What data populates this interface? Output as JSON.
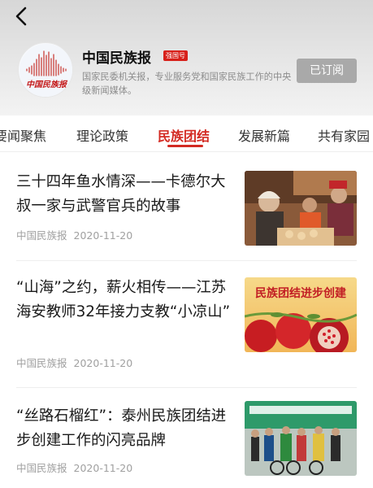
{
  "header": {
    "account_name": "中国民族报",
    "badge": "强国号",
    "description": "国家民委机关报，专业服务党和国家民族工作的中央级新闻媒体。",
    "subscribe_label": "已订阅",
    "logo_text": "中国民族报"
  },
  "tabs": [
    {
      "label": "要闻聚焦"
    },
    {
      "label": "理论政策"
    },
    {
      "label": "民族团结"
    },
    {
      "label": "发展新篇"
    },
    {
      "label": "共有家园"
    }
  ],
  "active_tab": "民族团结",
  "articles": [
    {
      "title": "三十四年鱼水情深——卡德尔大叔一家与武警官兵的故事",
      "source": "中国民族报",
      "date": "2020-11-20"
    },
    {
      "title": "“山海”之约，薪火相传——江苏海安教师32年接力支教“小凉山”",
      "source": "中国民族报",
      "date": "2020-11-20",
      "image_text": "民族团结进步创建"
    },
    {
      "title": "“丝路石榴红”：泰州民族团结进步创建工作的闪亮品牌",
      "source": "中国民族报",
      "date": "2020-11-20"
    }
  ],
  "colors": {
    "accent": "#d32a22",
    "badge": "#d7201a",
    "subscribed_button": "#a9a9a9",
    "meta_text": "#a0a0a0"
  },
  "icons": {
    "back": "chevron-left-icon"
  }
}
